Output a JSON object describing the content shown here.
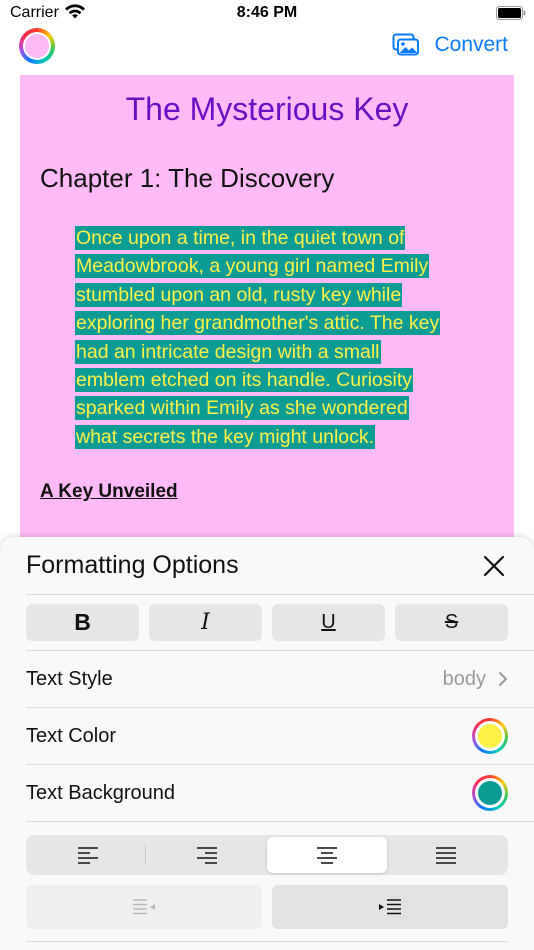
{
  "status_bar": {
    "carrier": "Carrier",
    "time": "8:46 PM"
  },
  "nav": {
    "convert_label": "Convert",
    "color_button_color": "#ffbaf7",
    "accent": "#0a7aff"
  },
  "document": {
    "background": "#ffbaf7",
    "title": "The Mysterious Key",
    "heading": "Chapter 1: The Discovery",
    "paragraph_lines": [
      "Once upon a time, in the quiet town of",
      "Meadowbrook, a young girl named Emily",
      "stumbled upon an old, rusty key while",
      "exploring her grandmother's attic. The key",
      "had an intricate design with a small",
      "emblem etched on its handle. Curiosity",
      "sparked within Emily as she wondered",
      "what secrets the key might unlock."
    ],
    "text_color": "#fff145",
    "highlight_color": "#0d9c95",
    "subheading": "A Key Unveiled"
  },
  "sheet": {
    "title": "Formatting Options",
    "format_buttons": {
      "bold": "B",
      "italic": "I",
      "underline": "U",
      "strikethrough": "S"
    },
    "text_style": {
      "label": "Text Style",
      "value": "body"
    },
    "text_color": {
      "label": "Text Color",
      "color": "#fff145"
    },
    "text_background": {
      "label": "Text Background",
      "color": "#0d9c95"
    },
    "alignment": {
      "options": [
        "left",
        "right",
        "center",
        "justified"
      ],
      "selected": "center"
    },
    "indent": {
      "decrease_enabled": false,
      "increase_enabled": true
    }
  }
}
